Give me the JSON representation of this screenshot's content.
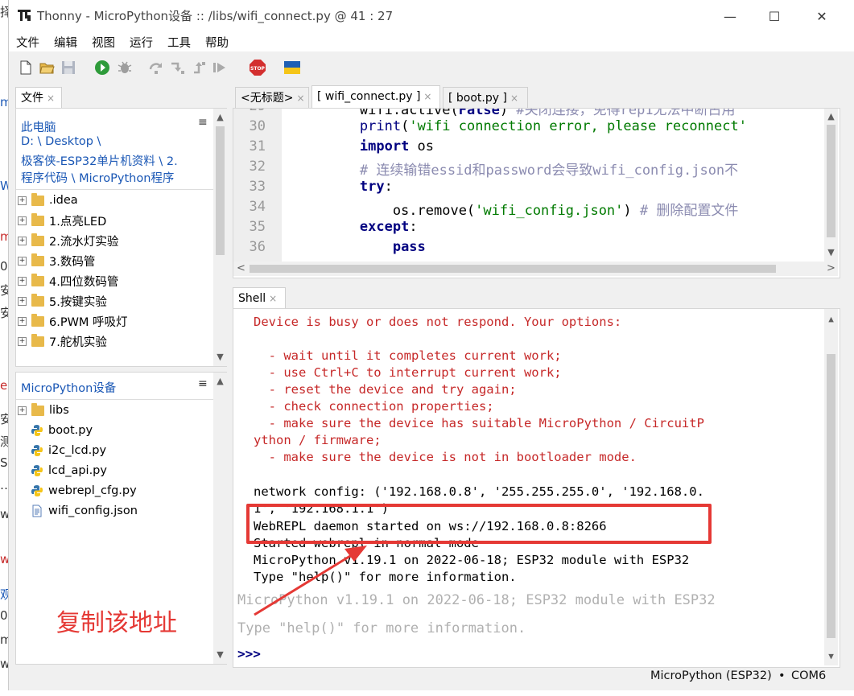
{
  "background_left_chars": [
    "择",
    "m",
    "W",
    "m",
    "0",
    "安",
    "安",
    "e",
    "安",
    "测",
    "S",
    "…",
    "w",
    "w",
    "观",
    "0",
    "m",
    "w"
  ],
  "window": {
    "app_icon": "thonny-icon",
    "title": "Thonny  -  MicroPython设备 :: /libs/wifi_connect.py  @  41 : 27",
    "min_label": "—",
    "max_label": "☐",
    "close_label": "✕"
  },
  "menu": [
    "文件",
    "编辑",
    "视图",
    "运行",
    "工具",
    "帮助"
  ],
  "toolbar_icons": [
    "new-file-icon",
    "open-file-icon",
    "save-icon",
    "run-icon",
    "debug-icon",
    "step-over-icon",
    "step-into-icon",
    "step-out-icon",
    "resume-icon",
    "stop-icon",
    "flag-icon"
  ],
  "stop_label": "STOP",
  "files_panel": {
    "tab": "文件",
    "tab_close": "×",
    "menu_icon": "≡",
    "local_title": "此电脑",
    "path_lines": [
      "D: \\ Desktop \\",
      "极客侠-ESP32单片机资料 \\ 2.",
      "程序代码 \\ MicroPython程序"
    ],
    "local_items": [
      ".idea",
      "1.点亮LED",
      "2.流水灯实验",
      "3.数码管",
      "4.四位数码管",
      "5.按键实验",
      "6.PWM 呼吸灯",
      "7.舵机实验"
    ],
    "device_title": "MicroPython设备",
    "device_items": [
      {
        "name": "libs",
        "type": "folder"
      },
      {
        "name": "boot.py",
        "type": "python"
      },
      {
        "name": "i2c_lcd.py",
        "type": "python"
      },
      {
        "name": "lcd_api.py",
        "type": "python"
      },
      {
        "name": "webrepl_cfg.py",
        "type": "python"
      },
      {
        "name": "wifi_config.json",
        "type": "file"
      }
    ]
  },
  "annotation": {
    "text": "复制该地址",
    "color": "#e53935"
  },
  "editor": {
    "tabs": [
      {
        "label": "<无标题>",
        "close": "×",
        "active": false
      },
      {
        "label": "[ wifi_connect.py ]",
        "close": "×",
        "active": true
      },
      {
        "label": "[ boot.py ]",
        "close": "×",
        "active": false
      }
    ],
    "lines": [
      {
        "num": "29",
        "code": "        wifi.active(False) #关闭连接，免得rep1无法中断占用"
      },
      {
        "num": "30",
        "code": "        print('wifi connection error, please reconnect'"
      },
      {
        "num": "31",
        "code": "        import os"
      },
      {
        "num": "32",
        "code": "        # 连续输错essid和password会导致wifi_config.json不"
      },
      {
        "num": "33",
        "code": "        try:"
      },
      {
        "num": "34",
        "code": "            os.remove('wifi_config.json') # 删除配置文件"
      },
      {
        "num": "35",
        "code": "        except:"
      },
      {
        "num": "36",
        "code": "            pass"
      }
    ]
  },
  "shell": {
    "tab": "Shell",
    "tab_close": "×",
    "error_lines": [
      "Device is busy or does not respond. Your options:",
      "",
      "  - wait until it completes current work;",
      "  - use Ctrl+C to interrupt current work;",
      "  - reset the device and try again;",
      "  - check connection properties;",
      "  - make sure the device has suitable MicroPython / CircuitP",
      "ython / firmware;",
      "  - make sure the device is not in bootloader mode."
    ],
    "output_lines": [
      "network config: ('192.168.0.8', '255.255.255.0', '192.168.0.",
      "1', '192.168.1.1')",
      "WebREPL daemon started on ws://192.168.0.8:8266",
      "Started webrepl in normal mode",
      "MicroPython v1.19.1 on 2022-06-18; ESP32 module with ESP32",
      "Type \"help()\" for more information."
    ],
    "faded_lines": [
      "MicroPython v1.19.1 on 2022-06-18; ESP32 module with ESP32",
      "Type \"help()\" for more information."
    ],
    "prompt": ">>>"
  },
  "statusbar": {
    "interpreter": "MicroPython (ESP32)",
    "sep": "•",
    "port": "COM6"
  },
  "colors": {
    "highlight_box": "#e53935",
    "keyword": "#000080",
    "string": "#007a00",
    "error": "#c62828",
    "link": "#1a57b5"
  }
}
